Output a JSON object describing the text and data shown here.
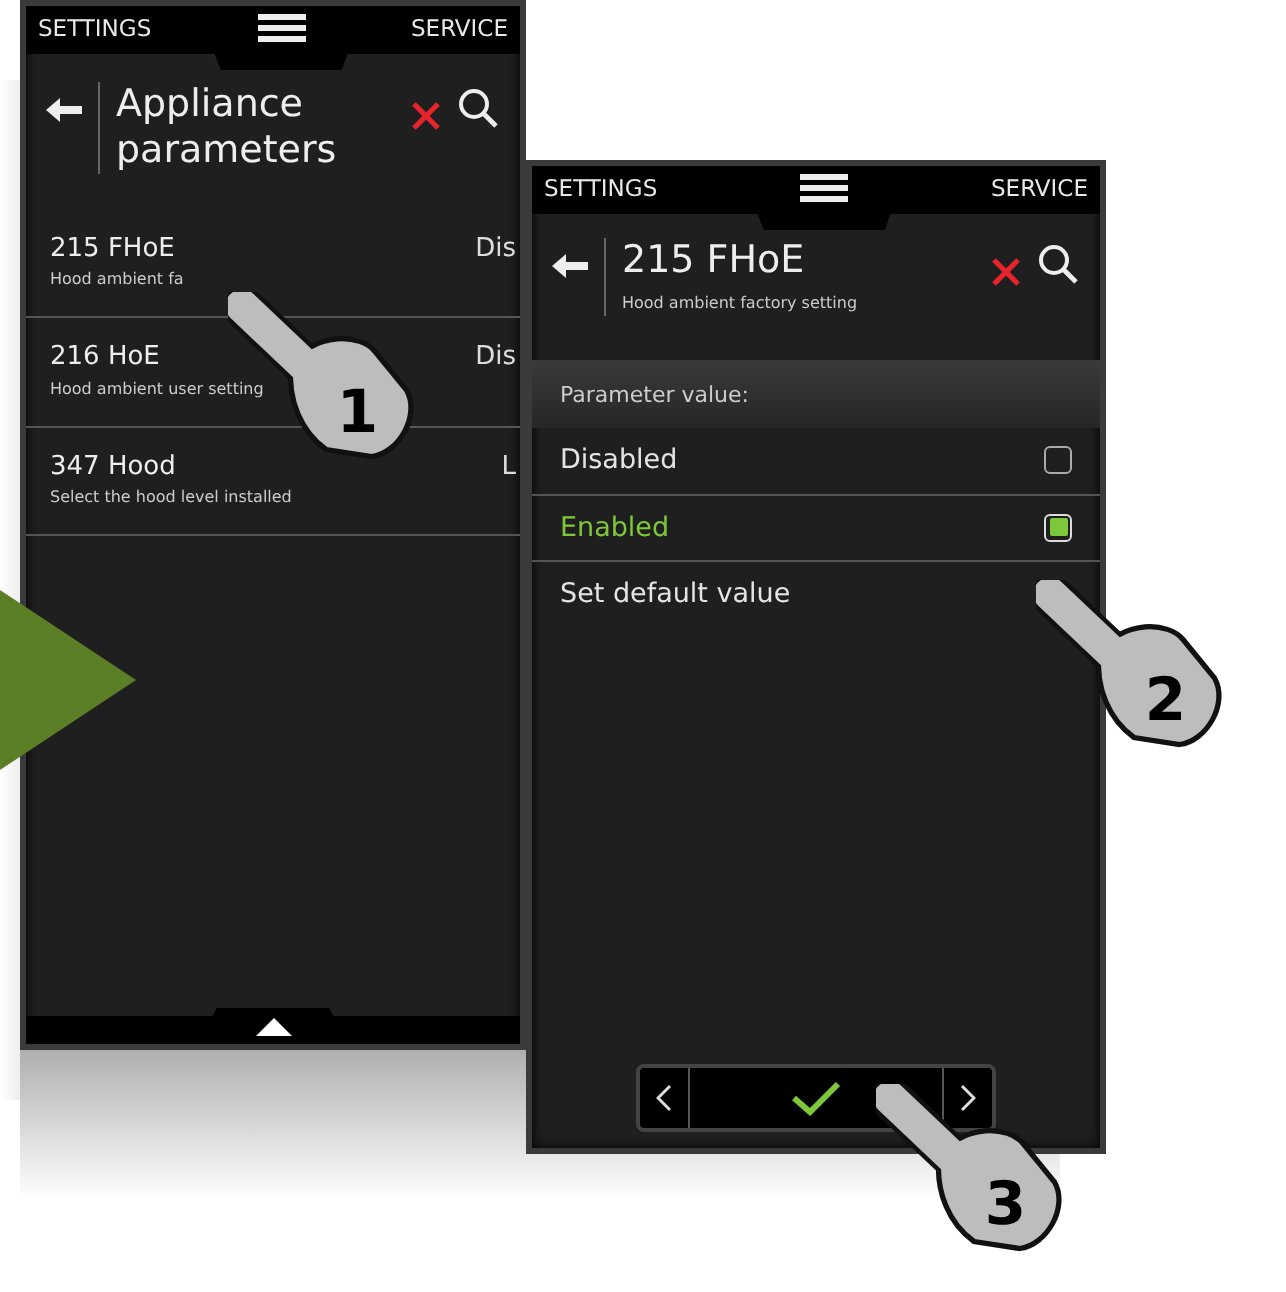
{
  "screens": [
    {
      "header": {
        "left": "SETTINGS",
        "right": "SERVICE"
      },
      "title": "Appliance parameters",
      "rows": [
        {
          "code": "215 FHoE",
          "description": "Hood ambient fa",
          "value": "Dis"
        },
        {
          "code": "216 HoE",
          "description": "Hood ambient user setting",
          "value": "Dis"
        },
        {
          "code": "347 Hood",
          "description": "Select the hood level installed",
          "value": "L"
        }
      ]
    },
    {
      "header": {
        "left": "SETTINGS",
        "right": "SERVICE"
      },
      "title": "215 FHoE",
      "subtitle": "Hood ambient factory setting",
      "section_label": "Parameter value:",
      "options": [
        {
          "kind": "checkbox",
          "label": "Disabled",
          "checked": false
        },
        {
          "kind": "checkbox",
          "label": "Enabled",
          "checked": true
        },
        {
          "kind": "action",
          "label": "Set default value"
        }
      ]
    }
  ],
  "steps": [
    "1",
    "2",
    "3"
  ]
}
